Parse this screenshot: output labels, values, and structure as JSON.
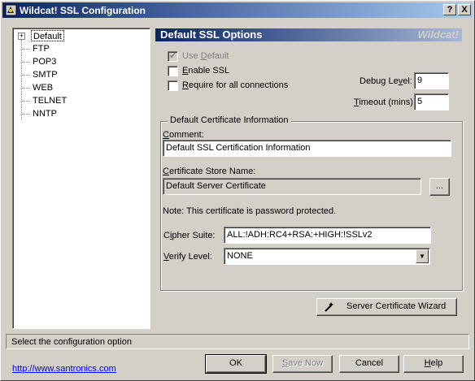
{
  "window": {
    "title": "Wildcat! SSL Configuration",
    "help_btn": "?",
    "close_btn": "X"
  },
  "tree": {
    "items": [
      "Default",
      "FTP",
      "POP3",
      "SMTP",
      "WEB",
      "TELNET",
      "NNTP"
    ],
    "expander": "+"
  },
  "header": {
    "title": "Default SSL Options",
    "brand": "Wildcat!"
  },
  "options": {
    "use_default": {
      "pre": "Use ",
      "key": "D",
      "post": "efault",
      "checked": true,
      "disabled": true
    },
    "enable_ssl": {
      "pre": "",
      "key": "E",
      "post": "nable SSL",
      "checked": false
    },
    "require_all": {
      "pre": "",
      "key": "R",
      "post": "equire for all connections",
      "checked": false
    },
    "debug_level": {
      "pre": "Debug Le",
      "key": "v",
      "post": "el:",
      "value": "9"
    },
    "timeout": {
      "pre": "",
      "key": "T",
      "post": "imeout (mins)",
      "value": "5"
    }
  },
  "cert_group": {
    "legend": "Default Certificate Information",
    "comment_label": {
      "pre": "",
      "key": "C",
      "post": "omment:"
    },
    "comment_value": "Default SSL Certification Information",
    "store_label": {
      "pre": "",
      "key": "C",
      "post": "ertificate Store Name:"
    },
    "store_value": "Default Server Certificate",
    "browse_button": "...",
    "note": "Note: This certificate is password protected.",
    "cipher_label": {
      "pre": "C",
      "key": "i",
      "post": "pher Suite:"
    },
    "cipher_value": "ALL:!ADH:RC4+RSA:+HIGH:!SSLv2",
    "verify_label": {
      "pre": "",
      "key": "V",
      "post": "erify Level:"
    },
    "verify_value": "NONE"
  },
  "wizard_button": "Server Certificate Wizard",
  "status_text": "Select the configuration option",
  "link_text": "http://www.santronics.com",
  "buttons": {
    "ok": "OK",
    "save_now": {
      "pre": "",
      "key": "S",
      "post": "ave Now"
    },
    "cancel": "Cancel",
    "help": {
      "pre": "",
      "key": "H",
      "post": "elp"
    }
  }
}
